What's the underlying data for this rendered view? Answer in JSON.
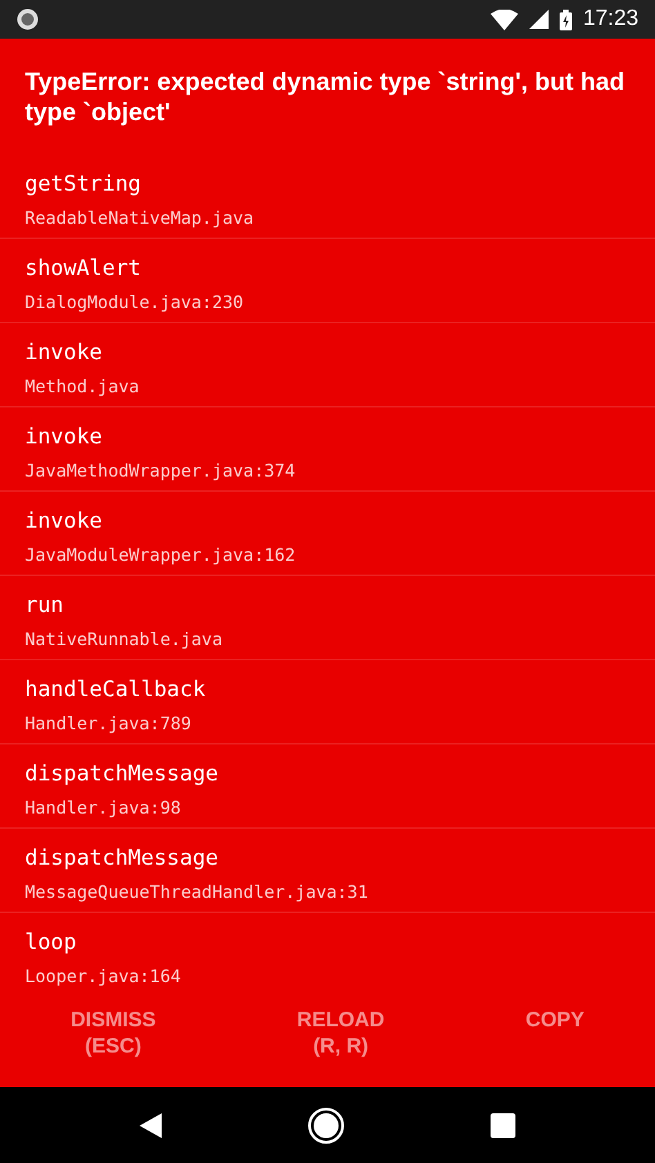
{
  "status_bar": {
    "time": "17:23"
  },
  "error": {
    "message": "TypeError: expected dynamic type `string', but had type `object'"
  },
  "stack": [
    {
      "method": "getString",
      "location": "ReadableNativeMap.java"
    },
    {
      "method": "showAlert",
      "location": "DialogModule.java:230"
    },
    {
      "method": "invoke",
      "location": "Method.java"
    },
    {
      "method": "invoke",
      "location": "JavaMethodWrapper.java:374"
    },
    {
      "method": "invoke",
      "location": "JavaModuleWrapper.java:162"
    },
    {
      "method": "run",
      "location": "NativeRunnable.java"
    },
    {
      "method": "handleCallback",
      "location": "Handler.java:789"
    },
    {
      "method": "dispatchMessage",
      "location": "Handler.java:98"
    },
    {
      "method": "dispatchMessage",
      "location": "MessageQueueThreadHandler.java:31"
    },
    {
      "method": "loop",
      "location": "Looper.java:164"
    }
  ],
  "buttons": [
    {
      "lines": [
        "DISMISS",
        "(ESC)"
      ]
    },
    {
      "lines": [
        "RELOAD",
        "(R, R)"
      ]
    },
    {
      "lines": [
        "COPY"
      ]
    }
  ]
}
